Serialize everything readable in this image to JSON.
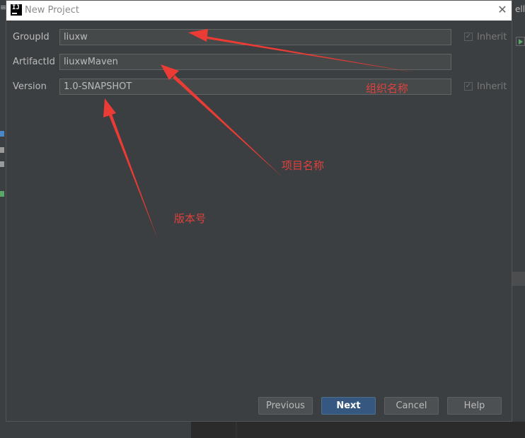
{
  "dialog": {
    "title": "New Project",
    "close_icon": "close-icon"
  },
  "form": {
    "group_id": {
      "label": "GroupId",
      "value": "liuxw",
      "inherit_label": "Inherit",
      "inherit_checked": true
    },
    "artifact_id": {
      "label": "ArtifactId",
      "value": "liuxwMaven"
    },
    "version": {
      "label": "Version",
      "value": "1.0-SNAPSHOT",
      "inherit_label": "Inherit",
      "inherit_checked": true
    }
  },
  "annotations": {
    "group": "组织名称",
    "artifact": "项目名称",
    "version": "版本号"
  },
  "buttons": {
    "previous": "Previous",
    "next": "Next",
    "cancel": "Cancel",
    "help": "Help"
  },
  "background": {
    "right_title_fragment": "elliJ"
  },
  "colors": {
    "accent": "#365880",
    "annotation": "#e0403e",
    "dialog_bg": "#3c3f41"
  }
}
